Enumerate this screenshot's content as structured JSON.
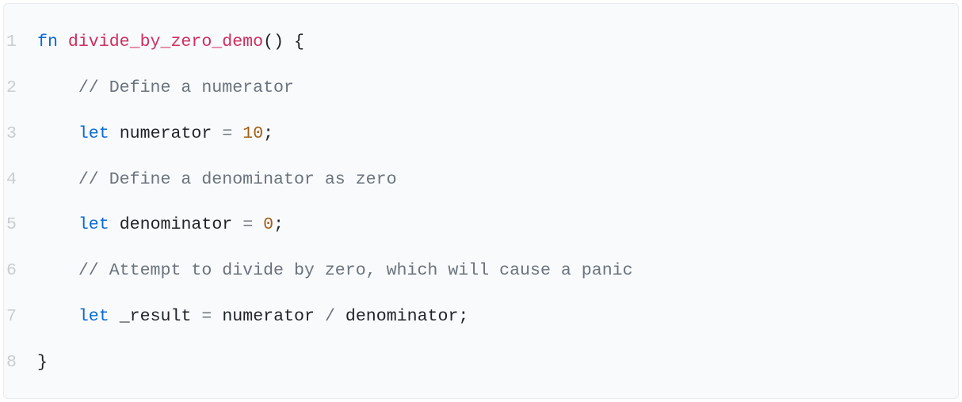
{
  "code": {
    "lines": [
      {
        "num": "1",
        "tokens": [
          {
            "class": "kw",
            "text": "fn"
          },
          {
            "class": "",
            "text": " "
          },
          {
            "class": "fn-name",
            "text": "divide_by_zero_demo"
          },
          {
            "class": "paren",
            "text": "()"
          },
          {
            "class": "",
            "text": " "
          },
          {
            "class": "punct",
            "text": "{"
          }
        ]
      },
      {
        "num": "2",
        "tokens": [
          {
            "class": "",
            "text": "    "
          },
          {
            "class": "comment",
            "text": "// Define a numerator"
          }
        ]
      },
      {
        "num": "3",
        "tokens": [
          {
            "class": "",
            "text": "    "
          },
          {
            "class": "kw",
            "text": "let"
          },
          {
            "class": "",
            "text": " "
          },
          {
            "class": "ident",
            "text": "numerator"
          },
          {
            "class": "",
            "text": " "
          },
          {
            "class": "op",
            "text": "="
          },
          {
            "class": "",
            "text": " "
          },
          {
            "class": "number",
            "text": "10"
          },
          {
            "class": "punct",
            "text": ";"
          }
        ]
      },
      {
        "num": "4",
        "tokens": [
          {
            "class": "",
            "text": "    "
          },
          {
            "class": "comment",
            "text": "// Define a denominator as zero"
          }
        ]
      },
      {
        "num": "5",
        "tokens": [
          {
            "class": "",
            "text": "    "
          },
          {
            "class": "kw",
            "text": "let"
          },
          {
            "class": "",
            "text": " "
          },
          {
            "class": "ident",
            "text": "denominator"
          },
          {
            "class": "",
            "text": " "
          },
          {
            "class": "op",
            "text": "="
          },
          {
            "class": "",
            "text": " "
          },
          {
            "class": "number",
            "text": "0"
          },
          {
            "class": "punct",
            "text": ";"
          }
        ]
      },
      {
        "num": "6",
        "tokens": [
          {
            "class": "",
            "text": "    "
          },
          {
            "class": "comment",
            "text": "// Attempt to divide by zero, which will cause a panic"
          }
        ]
      },
      {
        "num": "7",
        "tokens": [
          {
            "class": "",
            "text": "    "
          },
          {
            "class": "kw",
            "text": "let"
          },
          {
            "class": "",
            "text": " "
          },
          {
            "class": "ident",
            "text": "_result"
          },
          {
            "class": "",
            "text": " "
          },
          {
            "class": "op",
            "text": "="
          },
          {
            "class": "",
            "text": " "
          },
          {
            "class": "ident",
            "text": "numerator"
          },
          {
            "class": "",
            "text": " "
          },
          {
            "class": "op",
            "text": "/"
          },
          {
            "class": "",
            "text": " "
          },
          {
            "class": "ident",
            "text": "denominator"
          },
          {
            "class": "punct",
            "text": ";"
          }
        ]
      },
      {
        "num": "8",
        "tokens": [
          {
            "class": "punct",
            "text": "}"
          }
        ]
      }
    ]
  }
}
